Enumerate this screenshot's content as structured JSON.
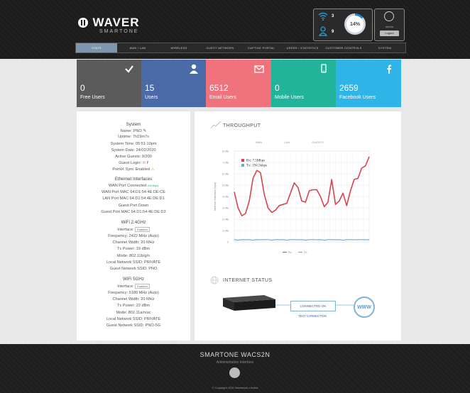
{
  "header": {
    "brand": "WAVER",
    "sub": "SMARTONE",
    "wifi_count": "3",
    "user_count": "9",
    "usage_percent": 14,
    "usage_label": "14%",
    "admin_label": "admin",
    "logout_label": "Logout"
  },
  "nav": {
    "items": [
      "Stats",
      "WAN / LAN",
      "Wireless",
      "Guest Network",
      "Captive Portal",
      "Users / Statistics",
      "Customer Controls",
      "System"
    ]
  },
  "tiles": [
    {
      "value": "0",
      "label": "Free Users",
      "color": "#5b5b5b",
      "icon": "check-icon"
    },
    {
      "value": "15",
      "label": "Users",
      "color": "#4b6aa8",
      "icon": "user-icon"
    },
    {
      "value": "6512",
      "label": "Email Users",
      "color": "#f0727c",
      "icon": "envelope-icon"
    },
    {
      "value": "0",
      "label": "Mobile Users",
      "color": "#21b49b",
      "icon": "mobile-icon"
    },
    {
      "value": "2659",
      "label": "Facebook Users",
      "color": "#2fb4e8",
      "icon": "facebook-icon"
    }
  ],
  "system": {
    "title": "System",
    "name": "Name: PNO",
    "uptime": "Uptime: 7h19m7s",
    "system_time": "System Time: 05:51:10pm",
    "system_date": "System Date: 24/02/2020",
    "active_guests": "Active Guests: 9/200",
    "guest_login": "Guest Login:",
    "pointx_sync": "PointX Sync Enabled",
    "eth_title": "Ethernet Interfaces",
    "wan_port": "WAN Port Connected",
    "wan_port_extra": "100 Mbps",
    "wan_mac": "WAN Port MAC 64:D1:54:4E:DE:CE",
    "lan_mac": "LAN Port MAC 64:D1:54:4E:DE:D1",
    "guest_port": "Guest Port Down",
    "guest_mac": "Guest Port MAC 64:D1:54:4E:DE:D2",
    "w24_title": "WiFi 2.4GHz",
    "w24_interface": "Interface:",
    "w24_interface_btn": "Enabled",
    "w24_freq": "Frequency: 2422 MHz (Auto)",
    "w24_width": "Channel Width: 20 MHz",
    "w24_power": "Tx Power: 19 dBm",
    "w24_mode": "Mode: 802.11b/g/n",
    "w24_local": "Local Network SSID: PRIVATE",
    "w24_guest": "Guest Network SSID: PNO",
    "w5_title": "WiFi 5GHz",
    "w5_interface": "Interface:",
    "w5_interface_btn": "Enabled",
    "w5_freq": "Frequency: 5180 MHz (Auto)",
    "w5_width": "Channel Width: 20 MHz",
    "w5_power": "Tx Power: 22 dBm",
    "w5_mode": "Mode: 802.11a/n/ac",
    "w5_local": "Local Network SSID: PRIVATE",
    "w5_guest": "Guest Network SSID: PNO-5G"
  },
  "throughput": {
    "title": "THROUGHPUT",
    "filters": [
      "WAN",
      "LAN",
      "GUESTS"
    ]
  },
  "chart_data": {
    "type": "line",
    "ylabel": "Internet Interface (bps)",
    "y_ticks": [
      "8.0M",
      "7.0M",
      "6.0M",
      "5.0M",
      "4.0M",
      "3.0M",
      "2.0M",
      "1.0M",
      "0"
    ],
    "ylim": [
      0,
      8
    ],
    "grid": true,
    "legend_placement": "top-left",
    "series": [
      {
        "name": "Rx",
        "label": "Rx: 7.5Mbps",
        "color": "#d9434f",
        "values": [
          4.4,
          3.0,
          2.3,
          2.5,
          3.6,
          5.6,
          6.3,
          6.1,
          4.2,
          3.0,
          2.6,
          2.8,
          3.2,
          3.3,
          3.4,
          4.3,
          5.2,
          4.8,
          3.6,
          3.5,
          4.5,
          4.6,
          4.6,
          4.0,
          3.1,
          3.5,
          5.5,
          3.3,
          3.6,
          4.3,
          3.2,
          4.5,
          5.5,
          5.6,
          6.5,
          6.7,
          7.5
        ]
      },
      {
        "name": "Tx",
        "label": "Tx: 194.5kbps",
        "color": "#6aa6d8",
        "values": [
          0.2,
          0.15,
          0.2,
          0.18,
          0.2,
          0.15,
          0.2,
          0.18,
          0.2,
          0.2,
          0.15,
          0.2,
          0.18,
          0.2,
          0.15,
          0.2,
          0.2,
          0.18,
          0.2,
          0.15,
          0.2,
          0.2,
          0.18,
          0.2,
          0.15,
          0.2,
          0.2,
          0.18,
          0.2,
          0.15,
          0.2,
          0.2,
          0.18,
          0.2,
          0.2,
          0.18,
          0.2
        ]
      }
    ],
    "bottom_legend": [
      "Rx",
      "Tx"
    ]
  },
  "internet_status": {
    "title": "INTERNET STATUS",
    "connected": "CONNECTED OK",
    "test": "TEST CONNECTION",
    "www": "WWW"
  },
  "footer": {
    "title": "SMARTONE WACS2N",
    "sub": "Administration Interface",
    "copyright": "© Copyright 2020 Waverlock Limited"
  }
}
